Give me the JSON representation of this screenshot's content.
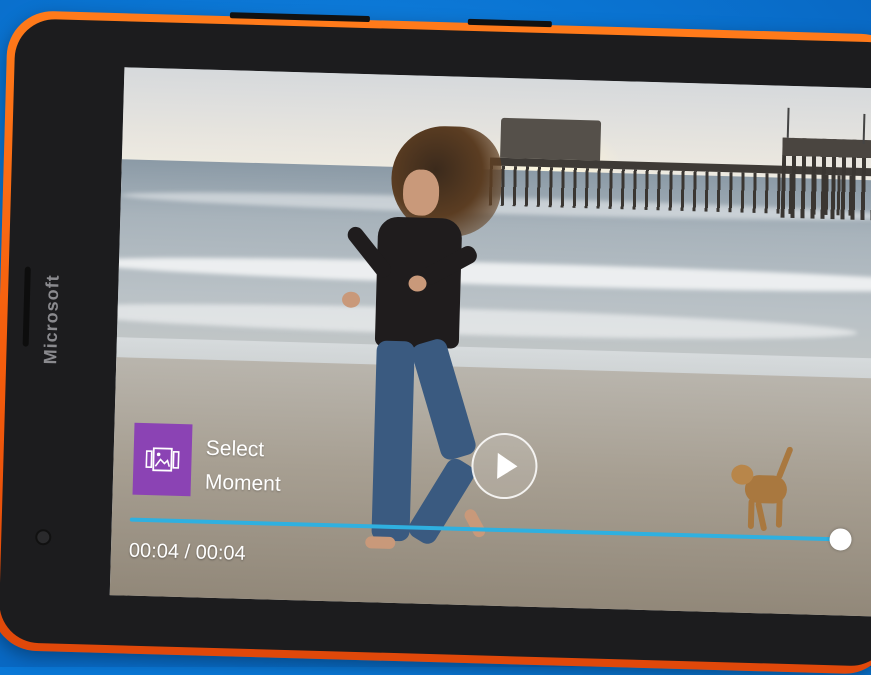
{
  "device": {
    "brand": "Microsoft",
    "body_color": "#f25a0c",
    "background_color": "#0a78d7"
  },
  "player": {
    "select_moment_label_line1": "Select",
    "select_moment_label_line2": "Moment",
    "select_moment_icon": "photo-frames-icon",
    "play_icon": "play-icon",
    "time_readout": "00:04 / 00:04",
    "progress": 1.0,
    "accent_color": "#2fb0e0",
    "tile_color": "#8b43b4"
  }
}
